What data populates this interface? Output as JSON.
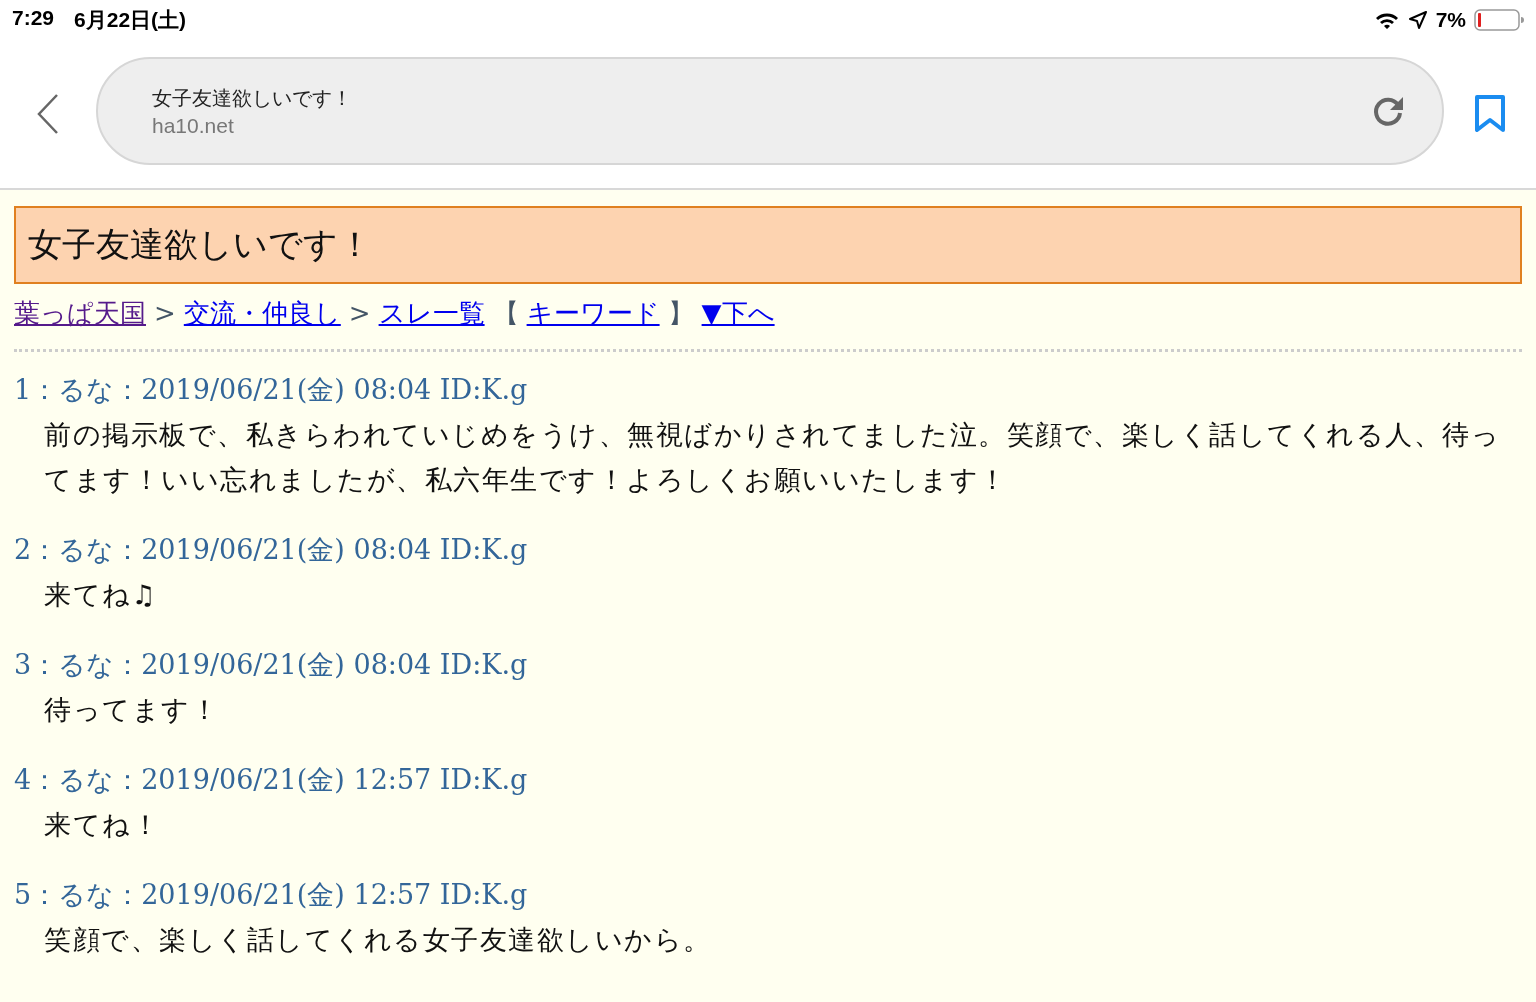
{
  "status_bar": {
    "time": "7:29",
    "date": "6月22日(土)",
    "battery_percent": "7%"
  },
  "address_bar": {
    "page_title": "女子友達欲しいです！",
    "domain": "ha10.net"
  },
  "thread_title": "女子友達欲しいです！",
  "breadcrumb": [
    {
      "kind": "link",
      "text": "葉っぱ天国",
      "visited": true
    },
    {
      "kind": "text",
      "text": ">"
    },
    {
      "kind": "link",
      "text": "交流・仲良し",
      "visited": false
    },
    {
      "kind": "text",
      "text": ">"
    },
    {
      "kind": "link",
      "text": "スレ一覧",
      "visited": false
    },
    {
      "kind": "text",
      "text": "【"
    },
    {
      "kind": "link",
      "text": "キーワード",
      "visited": false
    },
    {
      "kind": "text",
      "text": "】"
    },
    {
      "kind": "link",
      "text": "▼下へ",
      "visited": false
    }
  ],
  "posts": [
    {
      "header": "1：るな：2019/06/21(金) 08:04 ID:K.g",
      "body": "前の掲示板で、私きらわれていじめをうけ、無視ばかりされてました泣。笑顔で、楽しく話してくれる人、待ってます！いい忘れましたが、私六年生です！よろしくお願いいたします！"
    },
    {
      "header": "2：るな：2019/06/21(金) 08:04 ID:K.g",
      "body": "来てね♫"
    },
    {
      "header": "3：るな：2019/06/21(金) 08:04 ID:K.g",
      "body": "待ってます！"
    },
    {
      "header": "4：るな：2019/06/21(金) 12:57 ID:K.g",
      "body": "来てね！"
    },
    {
      "header": "5：るな：2019/06/21(金) 12:57 ID:K.g",
      "body": "笑顔で、楽しく話してくれる女子友達欲しいから。"
    }
  ]
}
